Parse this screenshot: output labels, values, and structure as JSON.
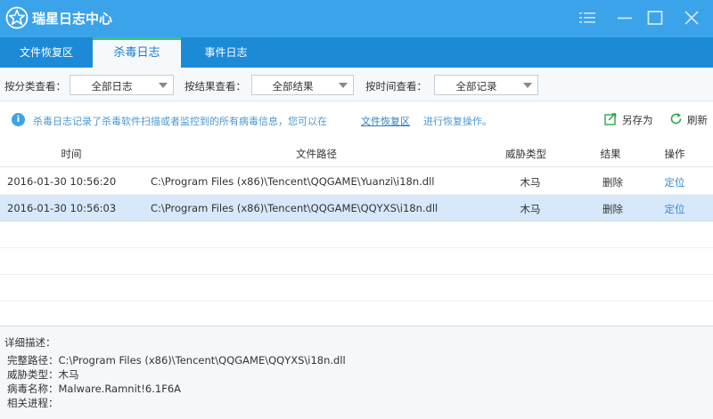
{
  "app": {
    "title": "瑞星日志中心"
  },
  "tabs": [
    {
      "label": "文件恢复区",
      "active": false
    },
    {
      "label": "杀毒日志",
      "active": true
    },
    {
      "label": "事件日志",
      "active": false
    }
  ],
  "filters": [
    {
      "label": "按分类查看：",
      "value": "全部日志"
    },
    {
      "label": "按结果查看：",
      "value": "全部结果"
    },
    {
      "label": "按时间查看：",
      "value": "全部记录"
    }
  ],
  "info": {
    "text_before": "杀毒日志记录了杀毒软件扫描或者监控到的所有病毒信息，您可以在",
    "link": "文件恢复区",
    "text_after": "进行恢复操作。",
    "save_as": "另存为",
    "refresh": "刷新"
  },
  "table": {
    "columns": [
      "时间",
      "文件路径",
      "威胁类型",
      "结果",
      "操作"
    ],
    "rows": [
      {
        "time": "2016-01-30 10:56:20",
        "path": "C:\\Program Files (x86)\\Tencent\\QQGAME\\Yuanzi\\i18n.dll",
        "threat": "木马",
        "result": "删除",
        "action": "定位",
        "selected": false
      },
      {
        "time": "2016-01-30 10:56:03",
        "path": "C:\\Program Files (x86)\\Tencent\\QQGAME\\QQYXS\\i18n.dll",
        "threat": "木马",
        "result": "删除",
        "action": "定位",
        "selected": true
      }
    ]
  },
  "detail": {
    "title": "详细描述：",
    "full_path_label": "完整路径：",
    "full_path": "C:\\Program Files (x86)\\Tencent\\QQGAME\\QQYXS\\i18n.dll",
    "threat_label": "威胁类型：",
    "threat": "木马",
    "virus_label": "病毒名称：",
    "virus": "Malware.Ramnit!6.1F6A",
    "process_label": "相关进程：",
    "process": ""
  },
  "colors": {
    "titlebar": "#3aa3ea",
    "tabbar": "#1d8ad8",
    "selected_row": "#d6e8fa",
    "link": "#3a8cd3",
    "active_tab_accent": "#3fc08a"
  }
}
